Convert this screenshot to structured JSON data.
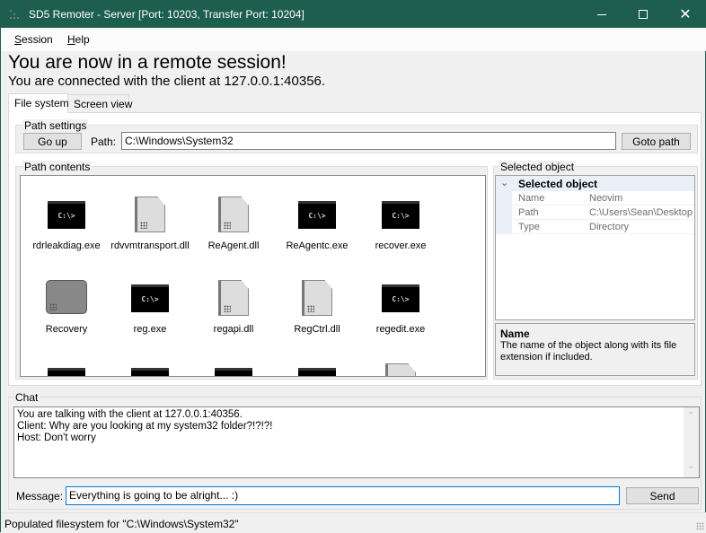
{
  "window": {
    "title": "SD5 Remoter - Server [Port: 10203, Transfer Port: 10204]",
    "accent": "#1e5e4e"
  },
  "menu": [
    {
      "label": "Session",
      "mnemonic": "S",
      "rest": "ession"
    },
    {
      "label": "Help",
      "mnemonic": "H",
      "rest": "elp"
    }
  ],
  "header": {
    "title": "You are now in a remote session!",
    "subtitle": "You are connected with the client at 127.0.0.1:40356."
  },
  "tabs": [
    {
      "label": "File system",
      "selected": true
    },
    {
      "label": "Screen view",
      "selected": false
    }
  ],
  "path_settings": {
    "group_label": "Path settings",
    "go_up": "Go up",
    "path_label": "Path:",
    "path_value": "C:\\Windows\\System32",
    "goto": "Goto path"
  },
  "path_contents": {
    "group_label": "Path contents",
    "items": [
      {
        "name": "rdrleakdiag.exe",
        "icon": "terminal-icon"
      },
      {
        "name": "rdvvmtransport.dll",
        "icon": "file-icon"
      },
      {
        "name": "ReAgent.dll",
        "icon": "file-icon"
      },
      {
        "name": "ReAgentc.exe",
        "icon": "terminal-icon"
      },
      {
        "name": "recover.exe",
        "icon": "terminal-icon"
      },
      {
        "name": "Recovery",
        "icon": "folder-icon"
      },
      {
        "name": "reg.exe",
        "icon": "terminal-icon"
      },
      {
        "name": "regapi.dll",
        "icon": "file-icon"
      },
      {
        "name": "RegCtrl.dll",
        "icon": "file-icon"
      },
      {
        "name": "regedit.exe",
        "icon": "terminal-icon"
      },
      {
        "name": "",
        "icon": "terminal-icon"
      },
      {
        "name": "",
        "icon": "terminal-icon"
      },
      {
        "name": "",
        "icon": "terminal-icon"
      },
      {
        "name": "",
        "icon": "terminal-icon"
      },
      {
        "name": "",
        "icon": "file-icon"
      }
    ],
    "terminal_glyph": "C:\\>"
  },
  "selected_object": {
    "group_label": "Selected object",
    "category": "Selected object",
    "properties": [
      {
        "key": "Name",
        "value": "Neovim"
      },
      {
        "key": "Path",
        "value": "C:\\Users\\Sean\\Desktop"
      },
      {
        "key": "Type",
        "value": "Directory"
      }
    ],
    "help_title": "Name",
    "help_text": "The name of the object along with its file extension if included."
  },
  "chat": {
    "group_label": "Chat",
    "lines": [
      "You are talking with the client at 127.0.0.1:40356.",
      "Client: Why are you looking at my system32 folder?!?!?!",
      "Host: Don't worry"
    ],
    "message_label": "Message:",
    "message_value": "Everything is going to be alright... :)",
    "send": "Send"
  },
  "status": {
    "text": "Populated filesystem for \"C:\\Windows\\System32\""
  }
}
